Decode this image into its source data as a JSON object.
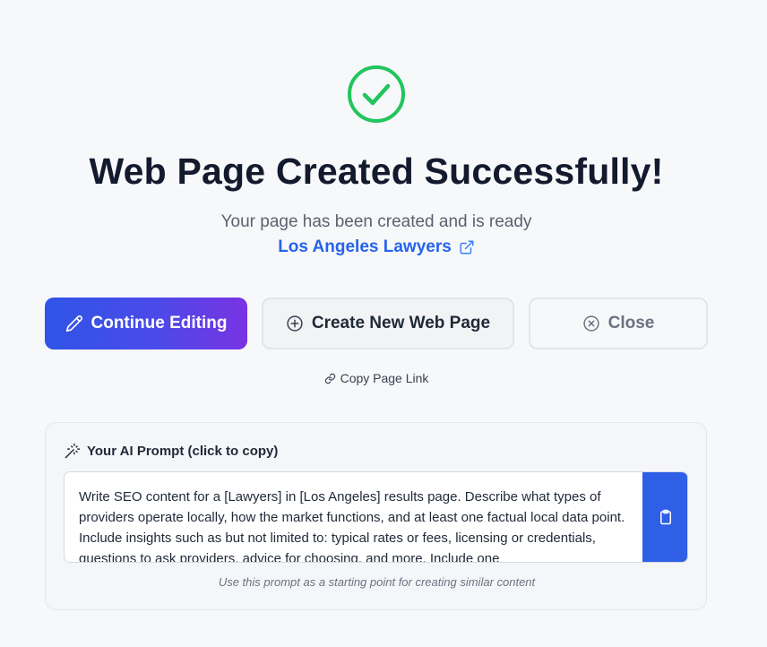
{
  "success": {
    "icon": "check-circle-icon",
    "title": "Web Page Created Successfully!",
    "subtitle": "Your page has been created and is ready",
    "page_link_label": "Los Angeles Lawyers"
  },
  "actions": {
    "continue_label": "Continue Editing",
    "create_label": "Create New Web Page",
    "close_label": "Close",
    "copy_link_label": "Copy Page Link"
  },
  "prompt": {
    "header": "Your AI Prompt (click to copy)",
    "text": "Write SEO content for a [Lawyers] in [Los Angeles] results page. Describe what types of providers operate locally, how the market functions, and at least one factual local data point. Include insights such as but not limited to: typical rates or fees, licensing or credentials, questions to ask providers, advice for choosing, and more. Include one",
    "hint": "Use this prompt as a starting point for creating similar content"
  },
  "colors": {
    "success_green": "#22c55e",
    "link_blue": "#2563eb",
    "primary_gradient_start": "#2f55e6",
    "primary_gradient_end": "#7a33e3"
  }
}
